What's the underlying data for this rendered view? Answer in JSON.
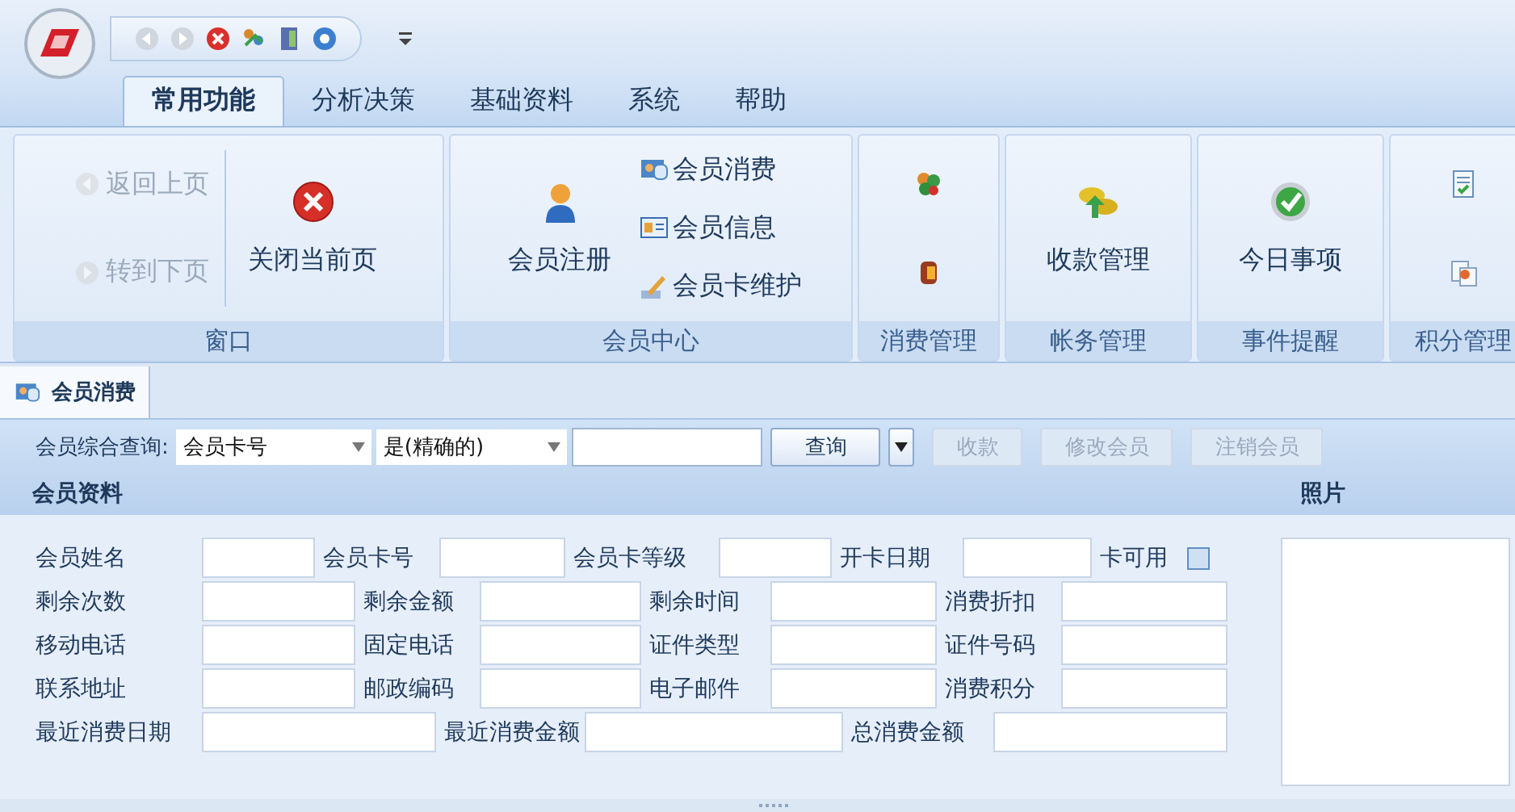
{
  "ribbon_tabs": [
    {
      "label": "常用功能",
      "selected": true
    },
    {
      "label": "分析决策",
      "selected": false
    },
    {
      "label": "基础资料",
      "selected": false
    },
    {
      "label": "系统",
      "selected": false
    },
    {
      "label": "帮助",
      "selected": false
    }
  ],
  "ribbon_groups": [
    {
      "title": "窗口",
      "items": [
        {
          "kind": "stack",
          "items": [
            {
              "label": "返回上页",
              "disabled": true
            },
            {
              "label": "转到下页",
              "disabled": true
            }
          ]
        },
        {
          "kind": "separator"
        },
        {
          "kind": "large",
          "label": "关闭当前页",
          "disabled": false
        }
      ]
    },
    {
      "title": "会员中心",
      "items": [
        {
          "kind": "large",
          "label": "会员注册",
          "disabled": false
        },
        {
          "kind": "stack",
          "items": [
            {
              "label": "会员消费",
              "disabled": false
            },
            {
              "label": "会员信息",
              "disabled": false
            },
            {
              "label": "会员卡维护",
              "disabled": false
            }
          ]
        }
      ]
    },
    {
      "title": "消费管理",
      "items": [
        {
          "kind": "stack",
          "items": [
            {
              "disabled": false
            },
            {
              "disabled": false
            }
          ]
        }
      ]
    },
    {
      "title": "帐务管理",
      "items": [
        {
          "kind": "large",
          "label": "收款管理",
          "disabled": false
        }
      ]
    },
    {
      "title": "事件提醒",
      "items": [
        {
          "kind": "large",
          "label": "今日事项",
          "disabled": false
        }
      ]
    },
    {
      "title": "积分管理",
      "items": [
        {
          "kind": "stack",
          "items": [
            {
              "disabled": false
            },
            {
              "disabled": false
            }
          ]
        }
      ]
    }
  ],
  "document_tabs": [
    {
      "label": "会员消费",
      "selected": true
    }
  ],
  "query_bar": {
    "label": "会员综合查询:",
    "field_combo": "会员卡号",
    "match_combo": "是(精确的)",
    "buttons": [
      {
        "kind": "text",
        "label": "查询",
        "disabled": false
      },
      {
        "kind": "dropdown",
        "disabled": false
      },
      {
        "kind": "text",
        "label": "收款",
        "disabled": true
      },
      {
        "kind": "text",
        "label": "修改会员",
        "disabled": true
      },
      {
        "kind": "text",
        "label": "注销会员",
        "disabled": true
      }
    ]
  },
  "section": {
    "title": "会员资料",
    "photo_title": "照片"
  },
  "form_rows": [
    {
      "kind": "a",
      "fields": [
        {
          "kind": "text",
          "label": "会员姓名"
        },
        {
          "kind": "text",
          "label": "会员卡号"
        },
        {
          "kind": "text",
          "label": "会员卡等级"
        },
        {
          "kind": "text",
          "label": "开卡日期"
        },
        {
          "kind": "checkbox",
          "label": "卡可用",
          "checked": false
        }
      ]
    },
    {
      "kind": "b",
      "fields": [
        {
          "kind": "text",
          "label": "剩余次数"
        },
        {
          "kind": "text",
          "label": "剩余金额"
        },
        {
          "kind": "text",
          "label": "剩余时间"
        },
        {
          "kind": "text",
          "label": "消费折扣"
        }
      ]
    },
    {
      "kind": "b",
      "fields": [
        {
          "kind": "text",
          "label": "移动电话"
        },
        {
          "kind": "text",
          "label": "固定电话"
        },
        {
          "kind": "text",
          "label": "证件类型"
        },
        {
          "kind": "text",
          "label": "证件号码"
        }
      ]
    },
    {
      "kind": "b",
      "fields": [
        {
          "kind": "text",
          "label": "联系地址"
        },
        {
          "kind": "text",
          "label": "邮政编码"
        },
        {
          "kind": "text",
          "label": "电子邮件"
        },
        {
          "kind": "text",
          "label": "消费积分"
        }
      ]
    },
    {
      "kind": "c",
      "fields": [
        {
          "kind": "text",
          "label": "最近消费日期"
        },
        {
          "kind": "text",
          "label": "最近消费金额"
        },
        {
          "kind": "text",
          "label": "总消费金额"
        }
      ]
    }
  ]
}
